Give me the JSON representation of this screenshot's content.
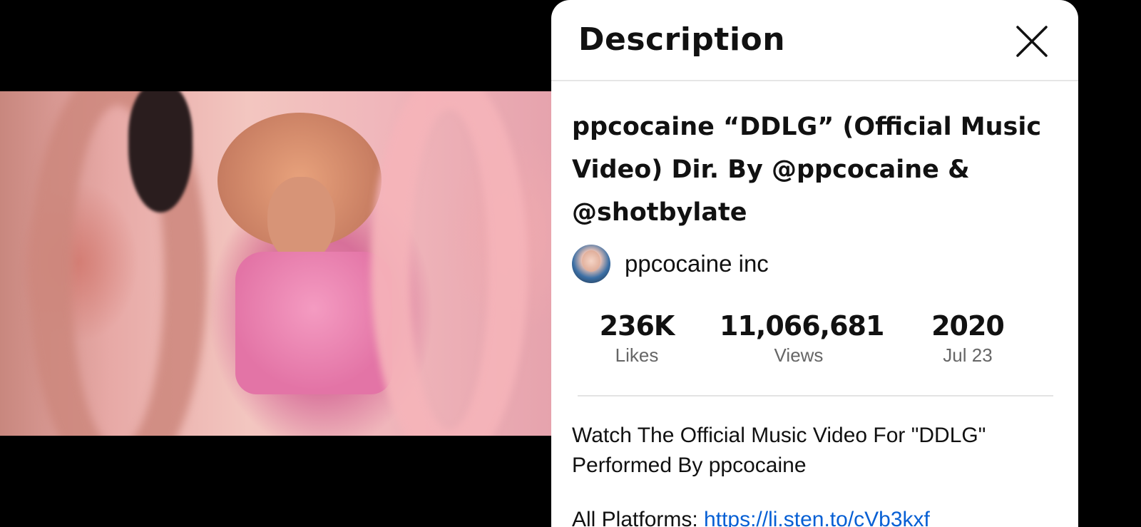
{
  "panel": {
    "title": "Description",
    "close_icon": "close-icon"
  },
  "video": {
    "title": "ppcocaine  “DDLG” (Official Music Video) Dir. By @ppcocaine & @shotbylate",
    "channel_name": "ppcocaine inc"
  },
  "stats": {
    "likes_value": "236K",
    "likes_label": "Likes",
    "views_value": "11,066,681",
    "views_label": "Views",
    "year_value": "2020",
    "date_label": "Jul 23"
  },
  "description": {
    "text": "Watch The Official Music Video For \"DDLG\" Performed By ppcocaine",
    "platforms_label": "All Platforms: ",
    "platforms_link": "https://li.sten.to/cVb3kxf"
  },
  "colors": {
    "link": "#065fd4",
    "panel_bg": "#ffffff",
    "backdrop": "#000000"
  }
}
